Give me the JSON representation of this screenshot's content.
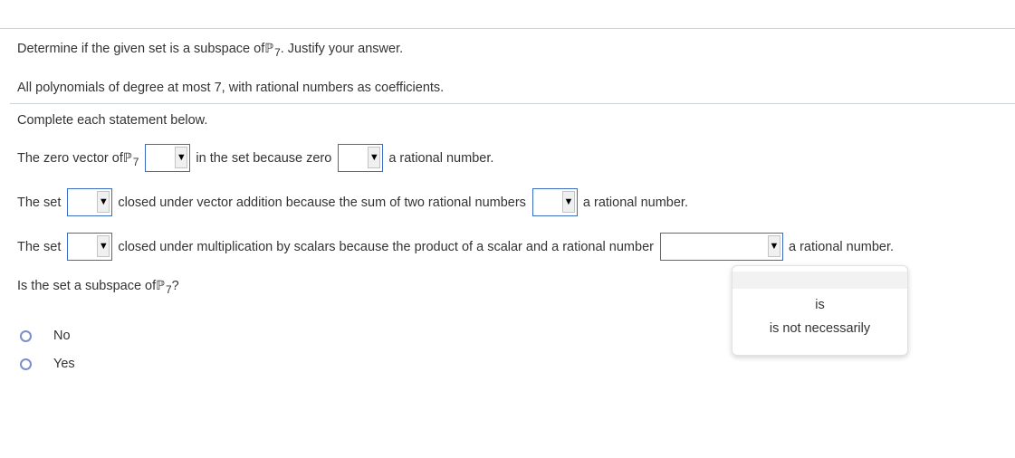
{
  "question": {
    "prompt_before": "Determine if the given set is a subspace of ",
    "space_symbol": "ℙ",
    "space_sub": "7",
    "prompt_after": ". Justify your answer.",
    "set_description": "All polynomials of degree at most 7, with rational numbers as coefficients.",
    "instruction": "Complete each statement below."
  },
  "statements": [
    {
      "pre": "The zero vector of ",
      "mid": "in the set because zero",
      "post": "a rational number.",
      "dropdown1_value": "",
      "dropdown2_value": ""
    },
    {
      "pre": "The set",
      "mid": "closed under vector addition because the sum of two rational numbers",
      "post": "a rational number.",
      "dropdown1_value": "",
      "dropdown2_value": ""
    },
    {
      "pre": "The set",
      "mid": "closed under multiplication by scalars because the product of a scalar and a rational number",
      "post": "a rational number.",
      "dropdown1_value": "",
      "dropdown2_value": ""
    }
  ],
  "dropdown_arrow": "▼",
  "open_menu": {
    "options": [
      "",
      "is",
      "is not necessarily"
    ]
  },
  "subspace_question": {
    "pre": "Is the set a subspace of ",
    "symbol": "ℙ",
    "sub": "7",
    "post": "?",
    "options": [
      {
        "label": "No",
        "selected": false
      },
      {
        "label": "Yes",
        "selected": false
      }
    ]
  }
}
